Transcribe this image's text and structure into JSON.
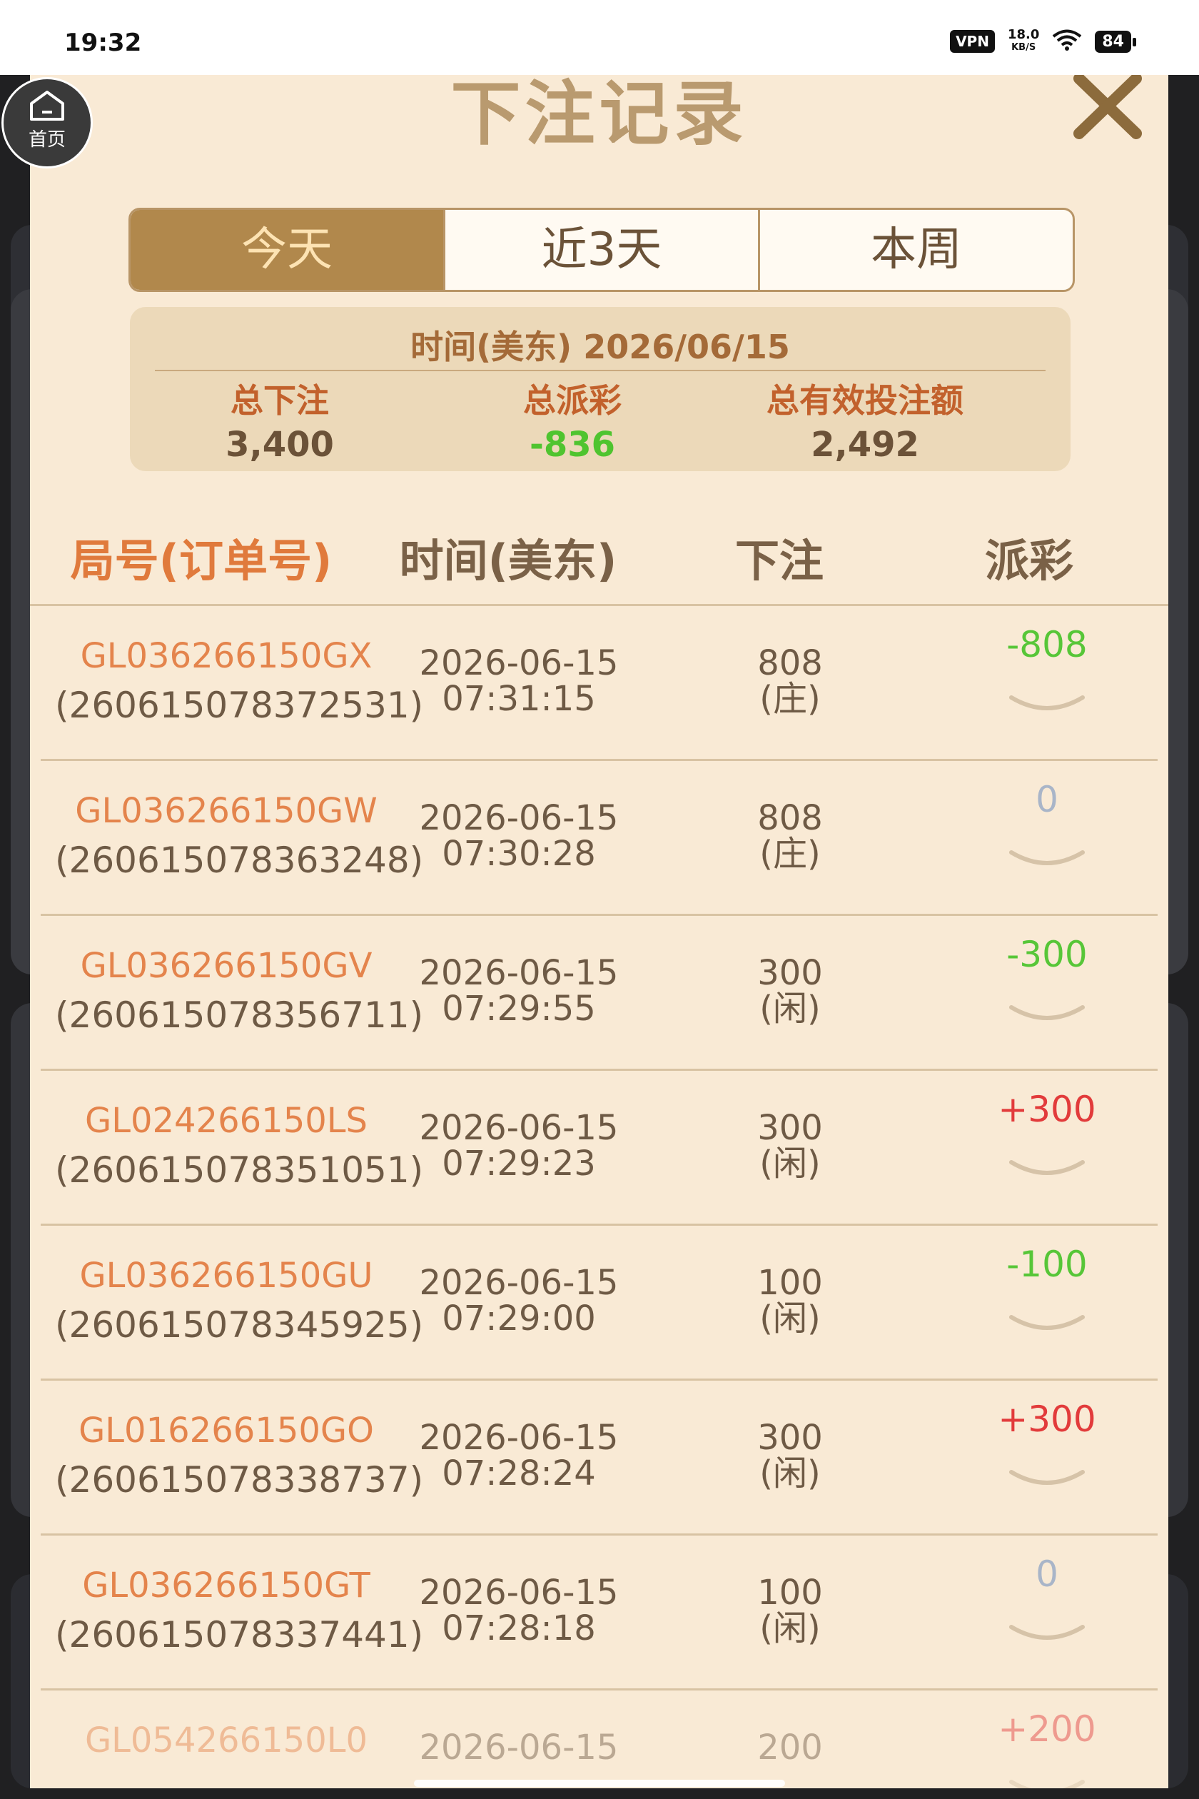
{
  "status_bar": {
    "time": "19:32",
    "vpn": "VPN",
    "net_speed_value": "18.0",
    "net_speed_unit": "KB/S",
    "battery": "84"
  },
  "home_button": {
    "label": "首页",
    "icon": "home-icon"
  },
  "dialog": {
    "title": "下注记录",
    "close_icon": "close-icon",
    "tabs": [
      {
        "label": "今天",
        "active": true
      },
      {
        "label": "近3天",
        "active": false
      },
      {
        "label": "本周",
        "active": false
      }
    ],
    "summary": {
      "date": "时间(美东) 2026/06/15",
      "total_bet_label": "总下注",
      "total_bet_value": "3,400",
      "total_payout_label": "总派彩",
      "total_payout_value": "-836",
      "total_valid_label": "总有效投注额",
      "total_valid_value": "2,492"
    },
    "table": {
      "headers": [
        "局号(订单号)",
        "时间(美东)",
        "下注",
        "派彩"
      ],
      "rows": [
        {
          "game_id": "GL036266150GX",
          "order_id": "(260615078372531)",
          "date": "2026-06-15",
          "time": "07:31:15",
          "bet": "808",
          "side": "(庄)",
          "payout": "-808",
          "type": "neg"
        },
        {
          "game_id": "GL036266150GW",
          "order_id": "(260615078363248)",
          "date": "2026-06-15",
          "time": "07:30:28",
          "bet": "808",
          "side": "(庄)",
          "payout": "0",
          "type": "zero"
        },
        {
          "game_id": "GL036266150GV",
          "order_id": "(260615078356711)",
          "date": "2026-06-15",
          "time": "07:29:55",
          "bet": "300",
          "side": "(闲)",
          "payout": "-300",
          "type": "neg"
        },
        {
          "game_id": "GL024266150LS",
          "order_id": "(260615078351051)",
          "date": "2026-06-15",
          "time": "07:29:23",
          "bet": "300",
          "side": "(闲)",
          "payout": "+300",
          "type": "pos"
        },
        {
          "game_id": "GL036266150GU",
          "order_id": "(260615078345925)",
          "date": "2026-06-15",
          "time": "07:29:00",
          "bet": "100",
          "side": "(闲)",
          "payout": "-100",
          "type": "neg"
        },
        {
          "game_id": "GL016266150GO",
          "order_id": "(260615078338737)",
          "date": "2026-06-15",
          "time": "07:28:24",
          "bet": "300",
          "side": "(闲)",
          "payout": "+300",
          "type": "pos"
        },
        {
          "game_id": "GL036266150GT",
          "order_id": "(260615078337441)",
          "date": "2026-06-15",
          "time": "07:28:18",
          "bet": "100",
          "side": "(闲)",
          "payout": "0",
          "type": "zero"
        },
        {
          "game_id": "GL054266150L0",
          "order_id": "",
          "date": "2026-06-15",
          "time": "",
          "bet": "200",
          "side": "",
          "payout": "+200",
          "type": "pos"
        }
      ]
    }
  }
}
